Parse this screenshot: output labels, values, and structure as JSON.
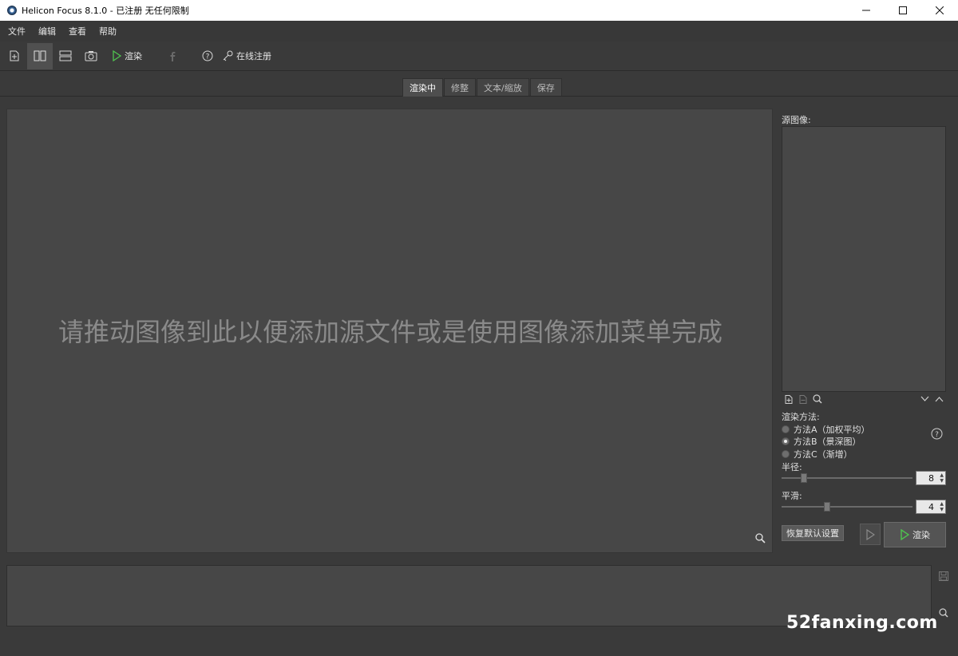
{
  "window": {
    "title": "Helicon Focus 8.1.0 - 已注册  无任何限制",
    "controls": {
      "minimize": "minimize",
      "maximize": "maximize",
      "close": "close"
    }
  },
  "menu": {
    "items": [
      {
        "label": "文件"
      },
      {
        "label": "编辑"
      },
      {
        "label": "查看"
      },
      {
        "label": "帮助"
      }
    ]
  },
  "toolbar": {
    "render_label": "渲染",
    "register_label": "在线注册",
    "icons": [
      "add-file-icon",
      "split-vertical-icon",
      "split-horizontal-icon",
      "camera-icon",
      "play-icon",
      "facebook-icon",
      "help-icon",
      "key-icon"
    ]
  },
  "tabs": [
    {
      "label": "渲染中",
      "active": true
    },
    {
      "label": "修整",
      "active": false
    },
    {
      "label": "文本/缩放",
      "active": false
    },
    {
      "label": "保存",
      "active": false
    }
  ],
  "preview": {
    "drop_hint": "请推动图像到此以便添加源文件或是使用图像添加菜单完成"
  },
  "right_panel": {
    "source_label": "源图像:",
    "method_label": "渲染方法:",
    "methods": [
      {
        "label": "方法A（加权平均）",
        "checked": false
      },
      {
        "label": "方法B（景深图）",
        "checked": true
      },
      {
        "label": "方法C（渐增）",
        "checked": false
      }
    ],
    "radius_label": "半径:",
    "radius_value": "8",
    "smoothing_label": "平滑:",
    "smoothing_value": "4",
    "reset_label": "恢复默认设置",
    "render_label": "渲染"
  },
  "watermark": "52fanxing.com",
  "colors": {
    "accent_green": "#4fc24f",
    "background": "#3a3a3a",
    "panel": "#474747"
  }
}
